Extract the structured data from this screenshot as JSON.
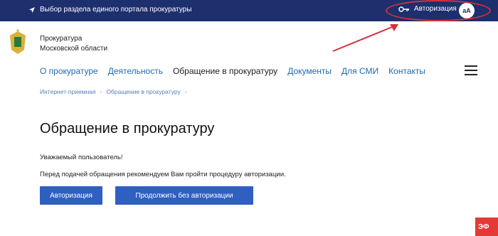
{
  "topbar": {
    "region_text": "Выбор раздела единого портала прокуратуры",
    "auth_label": "Авторизация",
    "font_size_label": "аА"
  },
  "org": {
    "line1": "Прокуратура",
    "line2": "Московской области"
  },
  "nav": {
    "items": [
      {
        "label": "О прокуратуре"
      },
      {
        "label": "Деятельность"
      },
      {
        "label": "Обращение в прокуратуру"
      },
      {
        "label": "Документы"
      },
      {
        "label": "Для СМИ"
      },
      {
        "label": "Контакты"
      }
    ]
  },
  "breadcrumb": {
    "items": [
      "Интернет-приемная",
      "Обращение в прокуратуру"
    ],
    "separator": "›"
  },
  "main": {
    "title": "Обращение в прокуратуру",
    "greeting": "Уважаемый пользователь!",
    "recommendation": "Перед подачей обращения рекомендуем Вам пройти процедуру авторизации.",
    "auth_button": "Авторизация",
    "continue_button": "Продолжить без авторизации"
  },
  "corner_badge": "ЭФ",
  "colors": {
    "topbar": "#1e2f6e",
    "button": "#2f5fc1",
    "link": "#1f6ab0",
    "annotation": "#d6303a"
  }
}
